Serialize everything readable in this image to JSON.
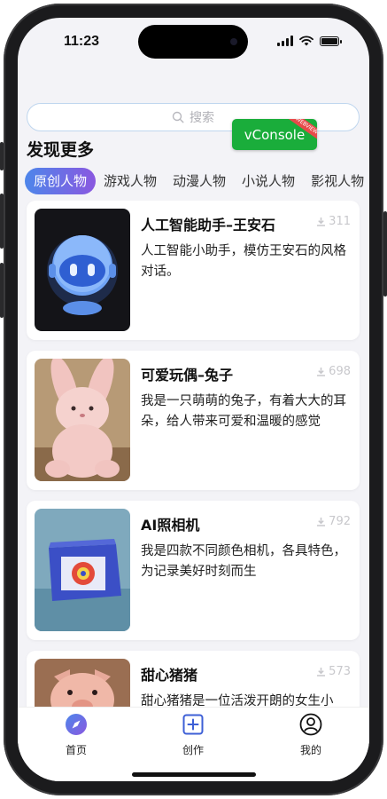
{
  "status_bar": {
    "time": "11:23"
  },
  "search": {
    "placeholder": "搜索"
  },
  "section_title": "发现更多",
  "tabs": [
    "原创人物",
    "游戏人物",
    "动漫人物",
    "小说人物",
    "影视人物"
  ],
  "active_tab": 0,
  "characters": [
    {
      "name": "人工智能助手–王安石",
      "downloads": "311",
      "description": "人工智能小助手，模仿王安石的风格对话。"
    },
    {
      "name": "可爱玩偶–兔子",
      "downloads": "698",
      "description": "我是一只萌萌的兔子，有着大大的耳朵，给人带来可爱和温暖的感觉"
    },
    {
      "name": "AI照相机",
      "downloads": "792",
      "description": "我是四款不同颜色相机，各具特色，为记录美好时刻而生"
    },
    {
      "name": "甜心猪猪",
      "downloads": "573",
      "description": "甜心猪猪是一位活泼开朗的女生小"
    }
  ],
  "vconsole": {
    "label": "vConsole",
    "ribbon": "WEBVIEW"
  },
  "tabbar": {
    "items": [
      {
        "label": "首页",
        "icon": "compass-icon"
      },
      {
        "label": "创作",
        "icon": "plus-square-icon"
      },
      {
        "label": "我的",
        "icon": "user-icon"
      }
    ]
  },
  "colors": {
    "accent_start": "#4d86ea",
    "accent_end": "#8a58e0",
    "vconsole": "#1aad3b"
  }
}
